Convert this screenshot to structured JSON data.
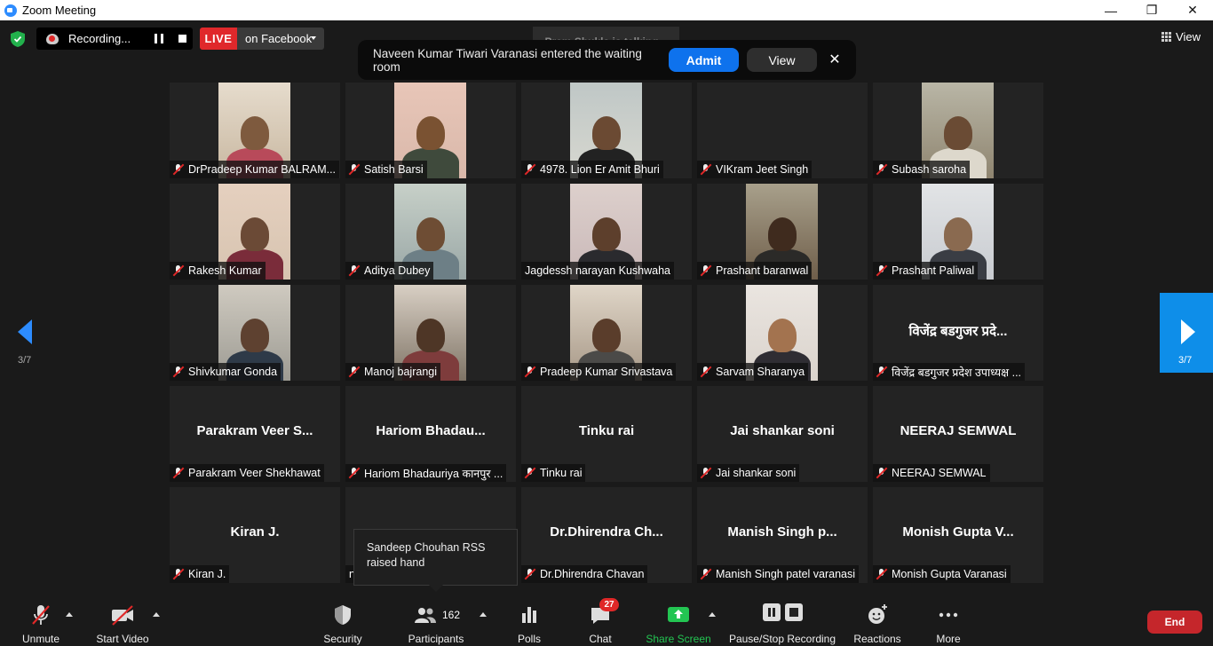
{
  "window": {
    "title": "Zoom Meeting",
    "controls": [
      "—",
      "❐",
      "✕"
    ]
  },
  "top_bar": {
    "recording_label": "Recording...",
    "live_badge": "LIVE",
    "live_destination": "on Facebook",
    "talking_indicator": "Prem Shukla is talking...",
    "view_label": "View"
  },
  "waiting_room_notice": {
    "message": "Naveen Kumar Tiwari Varanasi entered the waiting room",
    "admit_label": "Admit",
    "view_label": "View",
    "close_glyph": "✕"
  },
  "pagination": {
    "left_page": "3/7",
    "right_page": "3/7"
  },
  "participants": [
    {
      "label": "DrPradeep Kumar BALRAM...",
      "video": true
    },
    {
      "label": "Satish Barsi",
      "video": true
    },
    {
      "label": "4978.   Lion Er Amit Bhuri",
      "video": true
    },
    {
      "label": "VIKram Jeet Singh",
      "video": false,
      "display_name": ""
    },
    {
      "label": "Subash saroha",
      "video": true
    },
    {
      "label": "Rakesh Kumar",
      "video": true
    },
    {
      "label": "Aditya Dubey",
      "video": true
    },
    {
      "label": "Jagdessh narayan Kushwaha",
      "video": true,
      "muted": false
    },
    {
      "label": "Prashant baranwal",
      "video": true
    },
    {
      "label": "Prashant Paliwal",
      "video": true
    },
    {
      "label": "Shivkumar Gonda",
      "video": true
    },
    {
      "label": "Manoj bajrangi",
      "video": true
    },
    {
      "label": "Pradeep Kumar Srivastava",
      "video": true
    },
    {
      "label": "Sarvam Sharanya",
      "video": true
    },
    {
      "label": "विजेंद्र बडगुजर प्रदेश उपाध्यक्ष ...",
      "video": false,
      "display_name": "विजेंद्र बडगुजर प्रदे..."
    },
    {
      "label": "Parakram Veer Shekhawat",
      "video": false,
      "display_name": "Parakram  Veer  S..."
    },
    {
      "label": "Hariom Bhadauriya कानपुर ...",
      "video": false,
      "display_name": "Hariom  Bhadau..."
    },
    {
      "label": "Tinku rai",
      "video": false,
      "display_name": "Tinku rai"
    },
    {
      "label": "Jai shankar soni",
      "video": false,
      "display_name": "Jai shankar soni"
    },
    {
      "label": "NEERAJ SEMWAL",
      "video": false,
      "display_name": "NEERAJ SEMWAL"
    },
    {
      "label": "Kiran J.",
      "video": false,
      "display_name": "Kiran J."
    },
    {
      "label": "n",
      "video": false,
      "display_name": "",
      "muted": false
    },
    {
      "label": "Dr.Dhirendra Chavan",
      "video": false,
      "display_name": "Dr.Dhirendra  Ch..."
    },
    {
      "label": "Manish Singh patel varanasi",
      "video": false,
      "display_name": "Manish  Singh  p..."
    },
    {
      "label": "Monish Gupta Varanasi",
      "video": false,
      "display_name": "Monish  Gupta  V..."
    }
  ],
  "raised_hand_notice": {
    "line1": "Sandeep Chouhan RSS",
    "line2": "raised hand"
  },
  "toolbar": {
    "unmute": "Unmute",
    "start_video": "Start Video",
    "security": "Security",
    "participants": "Participants",
    "participant_count": "162",
    "polls": "Polls",
    "chat": "Chat",
    "chat_badge": "27",
    "share_screen": "Share Screen",
    "pause_stop_recording": "Pause/Stop Recording",
    "reactions": "Reactions",
    "more": "More",
    "end": "End"
  },
  "colors": {
    "accent": "#2d8cff",
    "admit": "#0e72ed",
    "live": "#e0282b",
    "end": "#c5262b",
    "share": "#23c552"
  }
}
